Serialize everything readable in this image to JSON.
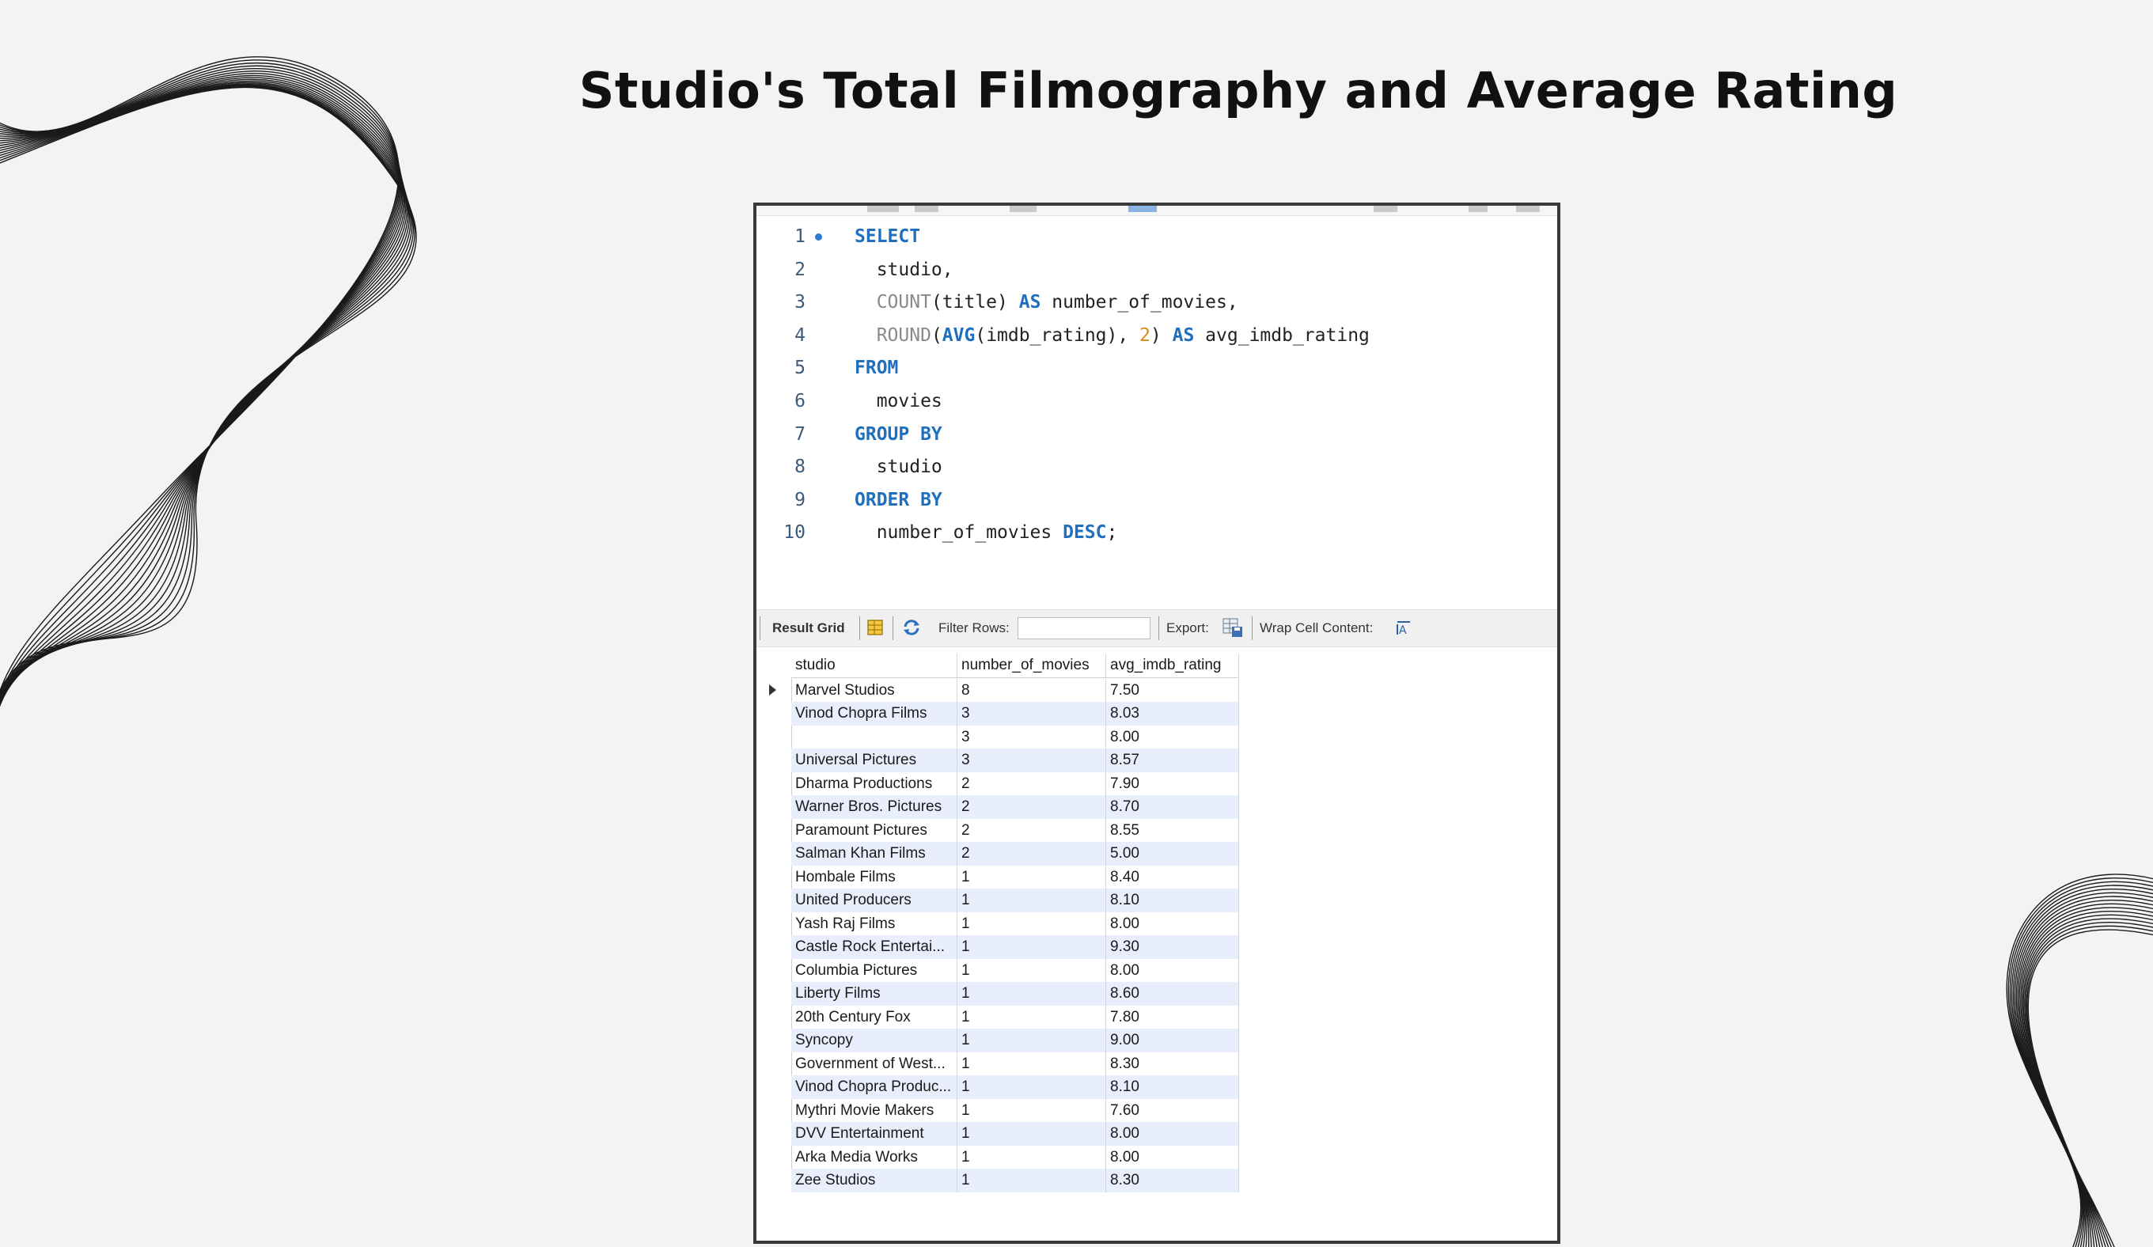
{
  "slide": {
    "title": "Studio's Total Filmography and Average Rating"
  },
  "editor": {
    "lines": [
      {
        "n": "1",
        "tokens": [
          [
            "kw",
            "SELECT"
          ]
        ]
      },
      {
        "n": "2",
        "tokens": [
          [
            "",
            "  studio,"
          ]
        ]
      },
      {
        "n": "3",
        "tokens": [
          [
            "fn",
            "  COUNT"
          ],
          [
            "",
            "(title) "
          ],
          [
            "kw",
            "AS"
          ],
          [
            "",
            " number_of_movies,"
          ]
        ]
      },
      {
        "n": "4",
        "tokens": [
          [
            "fn",
            "  ROUND"
          ],
          [
            "",
            "("
          ],
          [
            "kw",
            "AVG"
          ],
          [
            "",
            "(imdb_rating), "
          ],
          [
            "num",
            "2"
          ],
          [
            "",
            ") "
          ],
          [
            "kw",
            "AS"
          ],
          [
            "",
            " avg_imdb_rating"
          ]
        ]
      },
      {
        "n": "5",
        "tokens": [
          [
            "kw",
            "FROM"
          ]
        ]
      },
      {
        "n": "6",
        "tokens": [
          [
            "",
            "  movies"
          ]
        ]
      },
      {
        "n": "7",
        "tokens": [
          [
            "kw",
            "GROUP BY"
          ]
        ]
      },
      {
        "n": "8",
        "tokens": [
          [
            "",
            "  studio"
          ]
        ]
      },
      {
        "n": "9",
        "tokens": [
          [
            "kw",
            "ORDER BY"
          ]
        ]
      },
      {
        "n": "10",
        "tokens": [
          [
            "",
            "  number_of_movies "
          ],
          [
            "kw",
            "DESC"
          ],
          [
            "",
            ";"
          ]
        ]
      }
    ]
  },
  "result_toolbar": {
    "result_grid_label": "Result Grid",
    "filter_rows_label": "Filter Rows:",
    "filter_value": "",
    "export_label": "Export:",
    "wrap_label": "Wrap Cell Content:"
  },
  "grid": {
    "columns": [
      "studio",
      "number_of_movies",
      "avg_imdb_rating"
    ],
    "rows": [
      [
        "Marvel Studios",
        "8",
        "7.50"
      ],
      [
        "Vinod Chopra Films",
        "3",
        "8.03"
      ],
      [
        "",
        "3",
        "8.00"
      ],
      [
        "Universal Pictures",
        "3",
        "8.57"
      ],
      [
        "Dharma Productions",
        "2",
        "7.90"
      ],
      [
        "Warner Bros. Pictures",
        "2",
        "8.70"
      ],
      [
        "Paramount Pictures",
        "2",
        "8.55"
      ],
      [
        "Salman Khan Films",
        "2",
        "5.00"
      ],
      [
        "Hombale Films",
        "1",
        "8.40"
      ],
      [
        "United Producers",
        "1",
        "8.10"
      ],
      [
        "Yash Raj Films",
        "1",
        "8.00"
      ],
      [
        "Castle Rock Entertai...",
        "1",
        "9.30"
      ],
      [
        "Columbia Pictures",
        "1",
        "8.00"
      ],
      [
        "Liberty Films",
        "1",
        "8.60"
      ],
      [
        "20th Century Fox",
        "1",
        "7.80"
      ],
      [
        "Syncopy",
        "1",
        "9.00"
      ],
      [
        "Government of West...",
        "1",
        "8.30"
      ],
      [
        "Vinod Chopra Produc...",
        "1",
        "8.10"
      ],
      [
        "Mythri Movie Makers",
        "1",
        "7.60"
      ],
      [
        "DVV Entertainment",
        "1",
        "8.00"
      ],
      [
        "Arka Media Works",
        "1",
        "8.00"
      ],
      [
        "Zee Studios",
        "1",
        "8.30"
      ]
    ]
  }
}
